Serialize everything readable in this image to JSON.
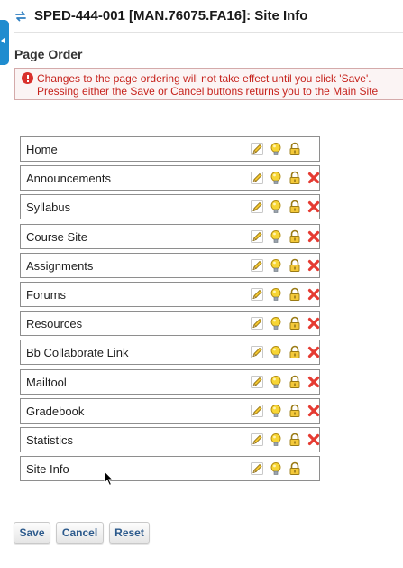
{
  "header": {
    "title": "SPED-444-001 [MAN.76075.FA16]: Site Info",
    "icon": "arrows-icon"
  },
  "section_title": "Page Order",
  "alert": {
    "line1": "Changes to the page ordering will not take effect until you click 'Save'.",
    "line2": "Pressing either the Save or Cancel buttons returns you to the Main Site"
  },
  "pages": [
    {
      "label": "Home",
      "removable": false
    },
    {
      "label": "Announcements",
      "removable": true
    },
    {
      "label": "Syllabus",
      "removable": true
    },
    {
      "label": "Course Site",
      "removable": true
    },
    {
      "label": "Assignments",
      "removable": true
    },
    {
      "label": "Forums",
      "removable": true
    },
    {
      "label": "Resources",
      "removable": true
    },
    {
      "label": "Bb Collaborate Link",
      "removable": true
    },
    {
      "label": "Mailtool",
      "removable": true
    },
    {
      "label": "Gradebook",
      "removable": true
    },
    {
      "label": "Statistics",
      "removable": true
    },
    {
      "label": "Site Info",
      "removable": false
    }
  ],
  "row_icons": [
    "pencil-icon",
    "lightbulb-icon",
    "padlock-icon",
    "delete-x-icon"
  ],
  "buttons": {
    "save": "Save",
    "cancel": "Cancel",
    "reset": "Reset"
  },
  "colors": {
    "accent": "#1f8ccf",
    "alert_text": "#c6231d",
    "button_text": "#2c5a8c"
  }
}
